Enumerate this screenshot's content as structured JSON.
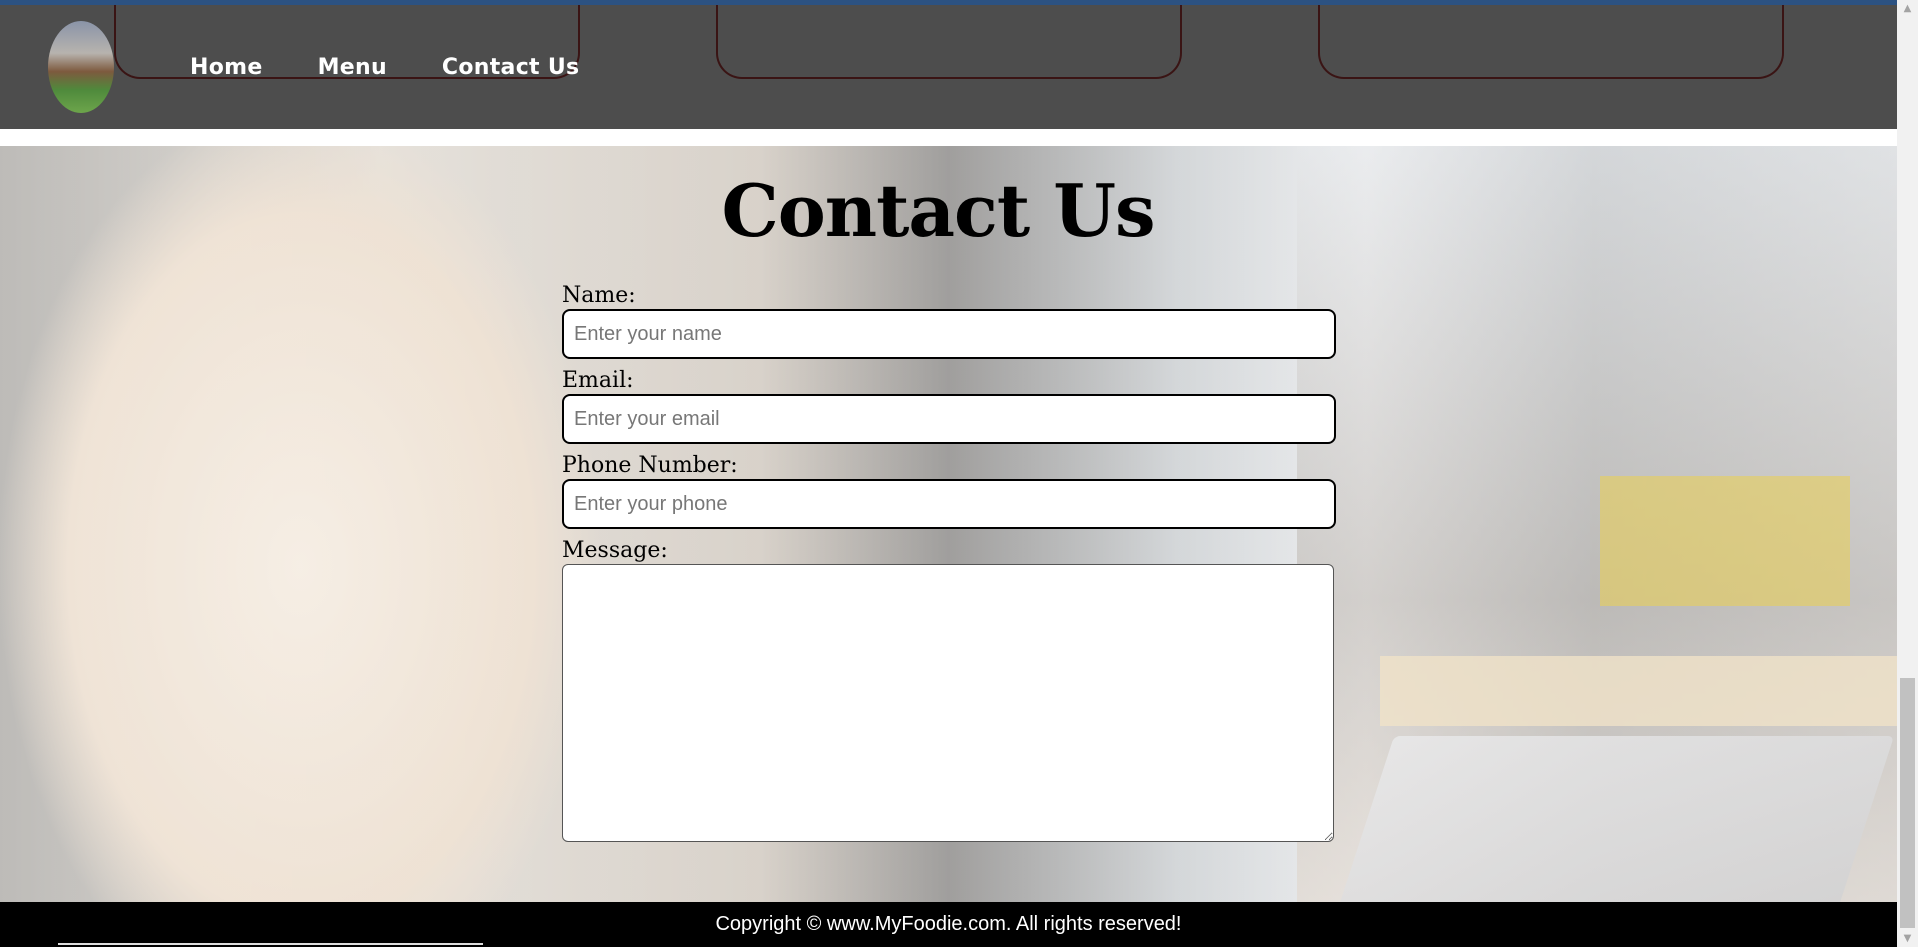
{
  "nav": {
    "links": [
      {
        "label": "Home"
      },
      {
        "label": "Menu"
      },
      {
        "label": "Contact Us"
      }
    ]
  },
  "main": {
    "title": "Contact Us",
    "form": {
      "name_label": "Name:",
      "name_placeholder": "Enter your name",
      "email_label": "Email:",
      "email_placeholder": "Enter your email",
      "phone_label": "Phone Number:",
      "phone_placeholder": "Enter your phone",
      "message_label": "Message:"
    }
  },
  "footer": {
    "text": "Copyright © www.MyFoodie.com. All rights reserved!"
  },
  "colors": {
    "navbar": "#4d4d4d",
    "footer": "#000000",
    "nav_box_border": "#3a1414"
  },
  "icons": {
    "scroll_up": "triangle-up-icon",
    "scroll_down": "triangle-down-icon"
  }
}
